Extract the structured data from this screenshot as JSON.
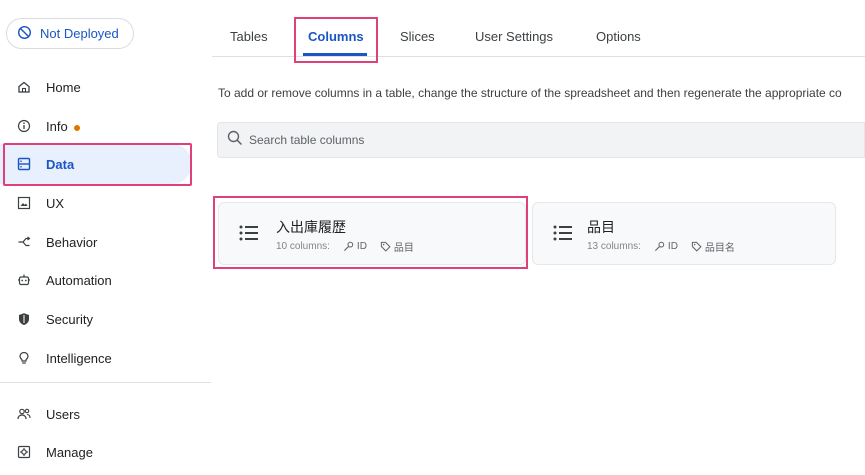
{
  "deploy_status": {
    "label": "Not Deployed",
    "icon": "not-deployed-icon"
  },
  "sidebar": {
    "items": [
      {
        "label": "Home",
        "icon": "home-icon"
      },
      {
        "label": "Info",
        "icon": "info-icon",
        "has_dot": true
      },
      {
        "label": "Data",
        "icon": "data-icon",
        "active": true
      },
      {
        "label": "UX",
        "icon": "ux-icon"
      },
      {
        "label": "Behavior",
        "icon": "behavior-icon"
      },
      {
        "label": "Automation",
        "icon": "automation-icon"
      },
      {
        "label": "Security",
        "icon": "shield-icon"
      },
      {
        "label": "Intelligence",
        "icon": "lightbulb-icon"
      },
      {
        "label": "Users",
        "icon": "users-icon"
      },
      {
        "label": "Manage",
        "icon": "manage-icon"
      }
    ]
  },
  "tabs": [
    {
      "label": "Tables"
    },
    {
      "label": "Columns",
      "active": true
    },
    {
      "label": "Slices"
    },
    {
      "label": "User Settings"
    },
    {
      "label": "Options"
    }
  ],
  "description": "To add or remove columns in a table, change the structure of the spreadsheet and then regenerate the appropriate co",
  "search": {
    "placeholder": "Search table columns"
  },
  "tables": [
    {
      "title": "入出庫履歴",
      "columns_label": "10 columns:",
      "key": "ID",
      "label_col": "品目"
    },
    {
      "title": "品目",
      "columns_label": "13 columns:",
      "key": "ID",
      "label_col": "品目名"
    }
  ],
  "colors": {
    "accent": "#1a56c4",
    "highlight": "#e0407a",
    "active_bg": "#e8f0fe",
    "dot": "#e37400"
  }
}
